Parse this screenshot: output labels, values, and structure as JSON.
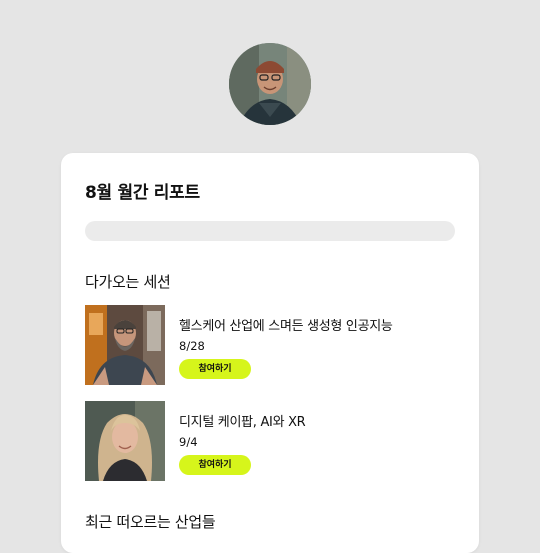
{
  "colors": {
    "background": "#e5e5e5",
    "card": "#ffffff",
    "accent_button": "#d6f51b",
    "progress_track": "#ebebeb"
  },
  "report": {
    "title": "8월 월간 리포트",
    "progress": 0
  },
  "upcoming": {
    "heading": "다가오는 세션",
    "sessions": [
      {
        "title": "헬스케어 산업에 스며든 생성형 인공지능",
        "date": "8/28",
        "button_label": "참여하기"
      },
      {
        "title": "디지털 케이팝, AI와 XR",
        "date": "9/4",
        "button_label": "참여하기"
      }
    ]
  },
  "trending": {
    "heading": "최근 떠오르는 산업들"
  }
}
